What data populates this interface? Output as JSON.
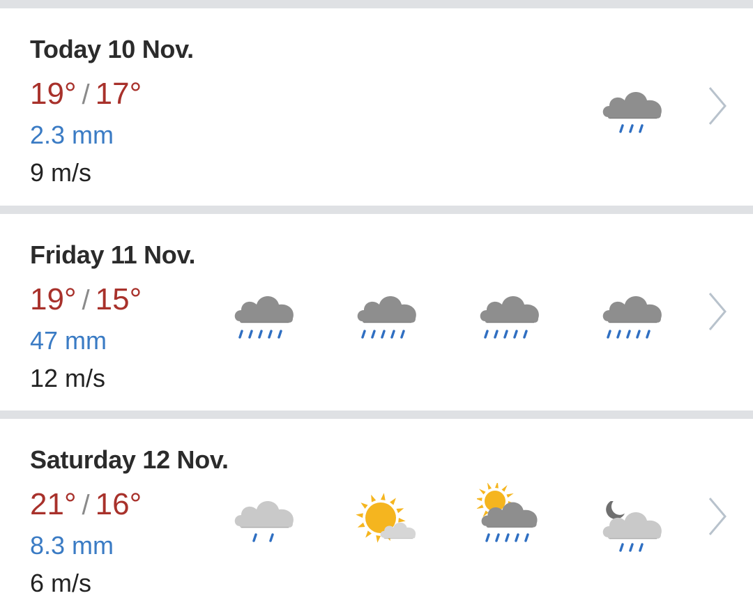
{
  "days": [
    {
      "title": "Today 10 Nov.",
      "high": "19°",
      "sep": "/",
      "low": "17°",
      "precip": "2.3 mm",
      "wind": "9 m/s",
      "icons": [
        null,
        null,
        null,
        "cloud-light-rain"
      ]
    },
    {
      "title": "Friday 11 Nov.",
      "high": "19°",
      "sep": "/",
      "low": "15°",
      "precip": "47 mm",
      "wind": "12 m/s",
      "icons": [
        "cloud-heavy-rain",
        "cloud-heavy-rain",
        "cloud-heavy-rain",
        "cloud-heavy-rain"
      ]
    },
    {
      "title": "Saturday 12 Nov.",
      "high": "21°",
      "sep": "/",
      "low": "16°",
      "precip": "8.3 mm",
      "wind": "6 m/s",
      "icons": [
        "light-cloud-light-rain",
        "sun-partly-cloudy",
        "sun-cloud-heavy-rain",
        "moon-cloud-light-rain"
      ]
    }
  ],
  "colors": {
    "temperature": "#a8312b",
    "precipitation": "#3a7bc4",
    "text": "#222222",
    "rain_drops": "#2f6fc2",
    "cloud_dark": "#8e8e8e",
    "cloud_light": "#c9c9c9",
    "sun": "#f5b51f",
    "chevron": "#b8c2cc"
  }
}
